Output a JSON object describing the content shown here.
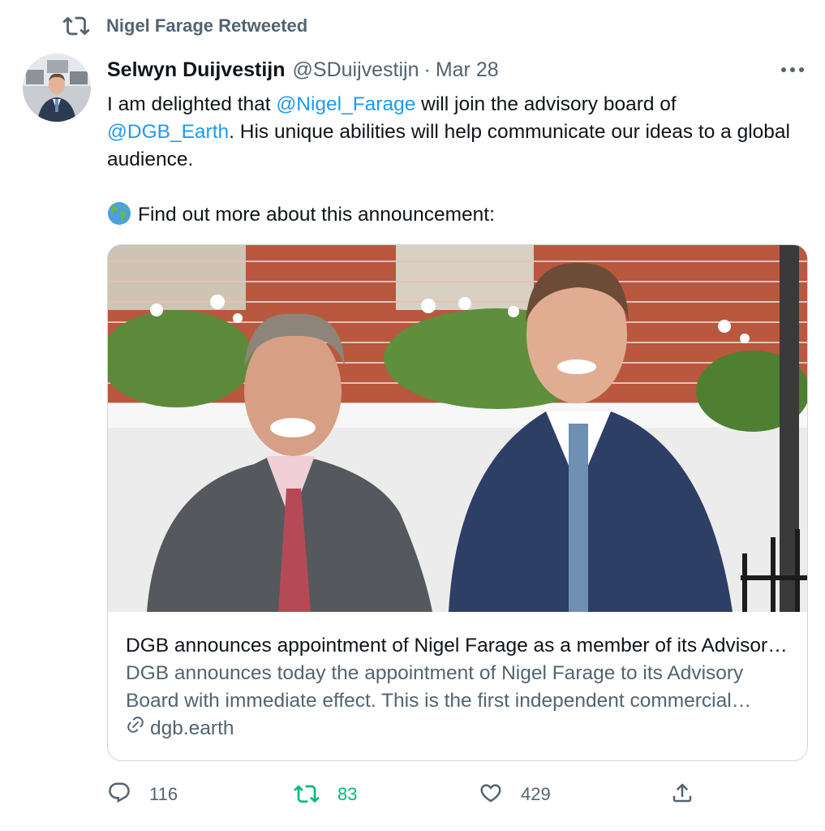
{
  "retweet_banner": {
    "text": "Nigel Farage Retweeted"
  },
  "tweet": {
    "author_name": "Selwyn Duijvestijn",
    "author_handle": "@SDuijvestijn",
    "separator": "·",
    "date": "Mar 28",
    "text": {
      "part1": "I am delighted that ",
      "mention1": "@Nigel_Farage",
      "part2": " will join the advisory board of ",
      "mention2": "@DGB_Earth",
      "part3": ". His unique abilities will help communicate our ideas to a global audience.",
      "line2": "Find out more about this announcement:"
    }
  },
  "card": {
    "title": "DGB announces appointment of Nigel Farage as a member of its Advisory Board",
    "description": "DGB announces today the appointment of Nigel Farage to its Advisory Board with immediate effect. This is the first independent commercial appointment",
    "domain": "dgb.earth"
  },
  "actions": {
    "reply_count": "116",
    "retweet_count": "83",
    "like_count": "429"
  },
  "colors": {
    "accent": "#1d9bf0",
    "retweet_green": "#00ba7c",
    "muted": "#536471"
  }
}
